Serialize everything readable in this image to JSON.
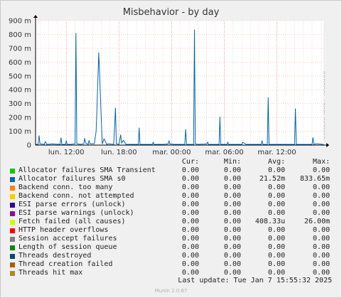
{
  "title": "Misbehavior - by day",
  "sidebar_text": "RRDTOOL / TOBI OETIKER",
  "footer": "Munin 2.0.67",
  "last_update": "Last update: Tue Jan  7 15:55:32 2025",
  "legend_headers": {
    "cur": "Cur:",
    "min": "Min:",
    "avg": "Avg:",
    "max": "Max:"
  },
  "legend": [
    {
      "name": "Allocator failures SMA Transient",
      "color": "#00cc00",
      "cur": "0.00",
      "min": "0.00",
      "avg": "0.00",
      "max": "0.00"
    },
    {
      "name": "Allocator failures SMA s0",
      "color": "#0066b3",
      "cur": "0.00",
      "min": "0.00",
      "avg": "21.52m",
      "max": "833.65m"
    },
    {
      "name": "Backend conn. too many",
      "color": "#ff8000",
      "cur": "0.00",
      "min": "0.00",
      "avg": "0.00",
      "max": "0.00"
    },
    {
      "name": "Backend conn. not attempted",
      "color": "#ffcc00",
      "cur": "0.00",
      "min": "0.00",
      "avg": "0.00",
      "max": "0.00"
    },
    {
      "name": "ESI parse errors (unlock)",
      "color": "#330099",
      "cur": "0.00",
      "min": "0.00",
      "avg": "0.00",
      "max": "0.00"
    },
    {
      "name": "ESI parse warnings (unlock)",
      "color": "#990099",
      "cur": "0.00",
      "min": "0.00",
      "avg": "0.00",
      "max": "0.00"
    },
    {
      "name": "Fetch failed (all causes)",
      "color": "#ccff00",
      "cur": "0.00",
      "min": "0.00",
      "avg": "408.33u",
      "max": "26.00m"
    },
    {
      "name": "HTTP header overflows",
      "color": "#ff0000",
      "cur": "0.00",
      "min": "0.00",
      "avg": "0.00",
      "max": "0.00"
    },
    {
      "name": "Session accept failures",
      "color": "#808080",
      "cur": "0.00",
      "min": "0.00",
      "avg": "0.00",
      "max": "0.00"
    },
    {
      "name": "Length of session queue",
      "color": "#008f00",
      "cur": "0.00",
      "min": "0.00",
      "avg": "0.00",
      "max": "0.00"
    },
    {
      "name": "Threads destroyed",
      "color": "#00487d",
      "cur": "0.00",
      "min": "0.00",
      "avg": "0.00",
      "max": "0.00"
    },
    {
      "name": "Thread creation failed",
      "color": "#b35a00",
      "cur": "0.00",
      "min": "0.00",
      "avg": "0.00",
      "max": "0.00"
    },
    {
      "name": "Threads hit max",
      "color": "#b38f00",
      "cur": "0.00",
      "min": "0.00",
      "avg": "0.00",
      "max": "0.00"
    }
  ],
  "colors": {
    "plot_bg": "#ffffff",
    "grid_minor": "#f0b0b0",
    "grid_major": "#e0c8c8",
    "axis": "#000000"
  },
  "chart_data": {
    "type": "line",
    "title": "Misbehavior - by day",
    "ylim": [
      0,
      900
    ],
    "y_unit": "m",
    "y_ticks": [
      0,
      100,
      200,
      300,
      400,
      500,
      600,
      700,
      800,
      900
    ],
    "y_tick_labels": [
      "0",
      "100 m",
      "200 m",
      "300 m",
      "400 m",
      "500 m",
      "600 m",
      "700 m",
      "800 m",
      "900 m"
    ],
    "x_ticks": [
      {
        "label": "lun. 12:00",
        "hour": 12
      },
      {
        "label": "lun. 18:00",
        "hour": 18
      },
      {
        "label": "mar. 00:00",
        "hour": 24
      },
      {
        "label": "mar. 06:00",
        "hour": 30
      },
      {
        "label": "mar. 12:00",
        "hour": 36
      }
    ],
    "x_range_hours": [
      8.5,
      41.3
    ],
    "grid": true,
    "series": [
      {
        "name": "Allocator failures SMA s0",
        "color": "#0066b3",
        "x": [
          8.5,
          8.8,
          8.9,
          9.0,
          9.5,
          9.6,
          9.8,
          10.4,
          11.3,
          11.4,
          11.5,
          11.9,
          12.0,
          12.1,
          12.5,
          13.0,
          13.1,
          13.2,
          13.6,
          14.0,
          14.1,
          14.2,
          14.5,
          14.6,
          14.7,
          15.2,
          15.4,
          15.5,
          15.7,
          16.1,
          16.3,
          16.5,
          16.6,
          16.8,
          17.4,
          17.6,
          17.7,
          18.0,
          18.2,
          18.3,
          18.5,
          18.8,
          20.2,
          20.3,
          20.4,
          21.0,
          21.8,
          21.9,
          22.0,
          23.0,
          23.6,
          23.7,
          23.8,
          24.3,
          25.5,
          25.6,
          25.7,
          26.5,
          26.6,
          26.7,
          27.0,
          28.0,
          28.1,
          28.2,
          28.8,
          29.4,
          29.5,
          29.6,
          30.3,
          30.4,
          30.5,
          31.0,
          32.0,
          32.1,
          32.5,
          33.5,
          34.2,
          34.3,
          34.4,
          34.9,
          35.0,
          35.1,
          35.5,
          36.5,
          37.2,
          37.8,
          38.0,
          38.1,
          38.2,
          38.5,
          39.5,
          40.0,
          40.1,
          40.2,
          40.5,
          41.3
        ],
        "y": [
          5,
          5,
          70,
          10,
          5,
          25,
          5,
          8,
          5,
          55,
          5,
          5,
          30,
          5,
          5,
          10,
          810,
          10,
          5,
          10,
          50,
          15,
          5,
          35,
          10,
          10,
          100,
          270,
          670,
          8,
          45,
          20,
          5,
          10,
          5,
          270,
          10,
          5,
          75,
          15,
          35,
          5,
          5,
          125,
          5,
          5,
          5,
          20,
          5,
          5,
          8,
          30,
          8,
          5,
          5,
          115,
          5,
          5,
          835,
          10,
          5,
          8,
          20,
          5,
          5,
          5,
          205,
          5,
          5,
          20,
          5,
          5,
          5,
          20,
          5,
          5,
          5,
          30,
          5,
          5,
          345,
          5,
          5,
          5,
          5,
          5,
          5,
          265,
          5,
          5,
          5,
          5,
          55,
          5,
          10,
          5
        ]
      }
    ]
  }
}
